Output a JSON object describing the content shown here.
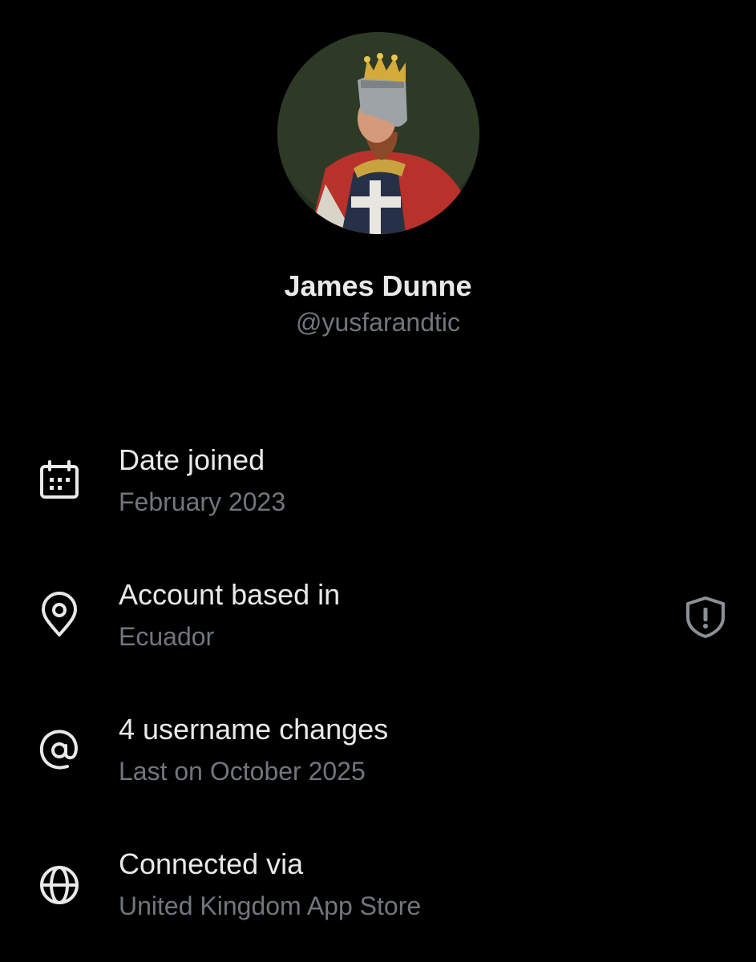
{
  "profile": {
    "display_name": "James Dunne",
    "handle": "@yusfarandtic",
    "avatar_icon": "avatar-crowned-knight-portrait"
  },
  "info_rows": [
    {
      "icon": "calendar-icon",
      "title": "Date joined",
      "value": "February 2023"
    },
    {
      "icon": "location-pin-icon",
      "title": "Account based in",
      "value": "Ecuador",
      "trailing_icon": "shield-alert-icon"
    },
    {
      "icon": "at-sign-icon",
      "title": "4 username changes",
      "value": "Last on October 2025"
    },
    {
      "icon": "globe-icon",
      "title": "Connected via",
      "value": "United Kingdom App Store"
    }
  ],
  "colors": {
    "background": "#000000",
    "primary_text": "#e7e9ea",
    "secondary_text": "#71767b"
  }
}
